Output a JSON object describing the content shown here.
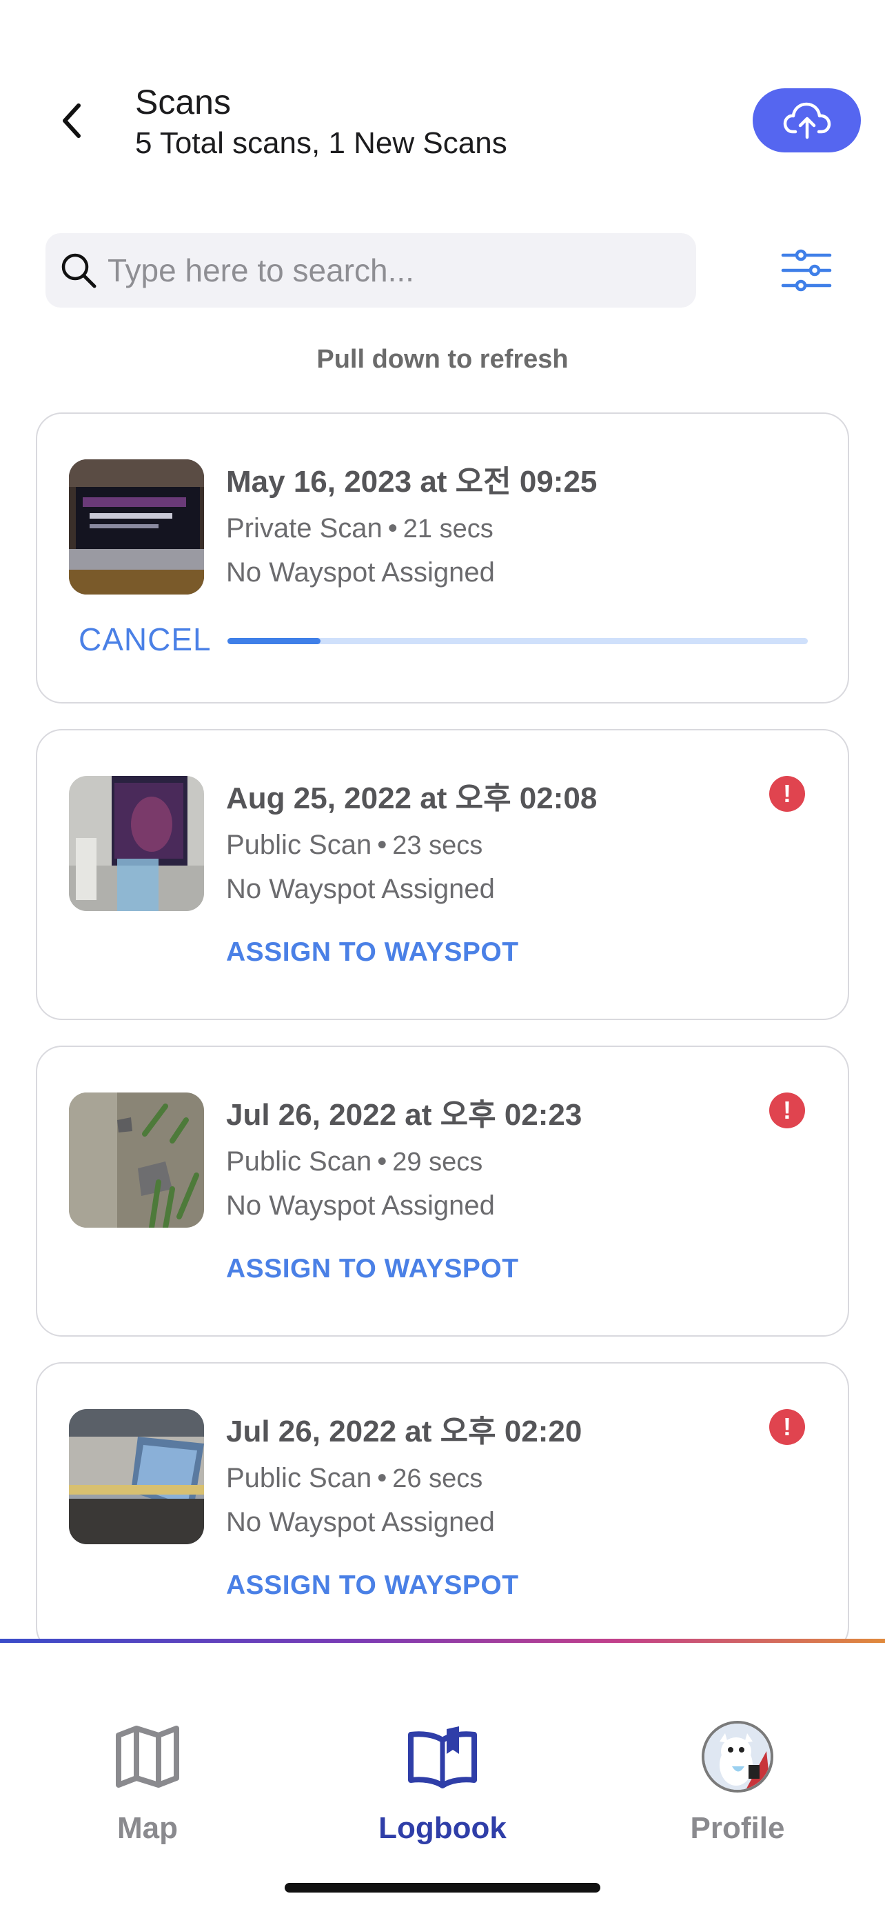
{
  "header": {
    "title": "Scans",
    "subtitle": "5 Total scans, 1 New Scans"
  },
  "search": {
    "placeholder": "Type here to search...",
    "value": ""
  },
  "refresh_hint": "Pull down to refresh",
  "scans": [
    {
      "date": "May 16, 2023 at 오전 09:25",
      "visibility": "Private Scan",
      "separator": "•",
      "duration": "21 secs",
      "wayspot": "No Wayspot Assigned",
      "action": "CANCEL",
      "progress": 0.16,
      "alert": false
    },
    {
      "date": "Aug 25, 2022 at 오후 02:08",
      "visibility": "Public Scan",
      "separator": "•",
      "duration": "23 secs",
      "wayspot": "No Wayspot Assigned",
      "action": "ASSIGN TO WAYSPOT",
      "alert": true,
      "alert_glyph": "!"
    },
    {
      "date": "Jul 26, 2022 at 오후 02:23",
      "visibility": "Public Scan",
      "separator": "•",
      "duration": "29 secs",
      "wayspot": "No Wayspot Assigned",
      "action": "ASSIGN TO WAYSPOT",
      "alert": true,
      "alert_glyph": "!"
    },
    {
      "date": "Jul 26, 2022 at 오후 02:20",
      "visibility": "Public Scan",
      "separator": "•",
      "duration": "26 secs",
      "wayspot": "No Wayspot Assigned",
      "action": "ASSIGN TO WAYSPOT",
      "alert": true,
      "alert_glyph": "!"
    }
  ],
  "nav": {
    "items": [
      {
        "label": "Map",
        "icon": "map-icon",
        "active": false
      },
      {
        "label": "Logbook",
        "icon": "logbook-icon",
        "active": true
      },
      {
        "label": "Profile",
        "icon": "avatar",
        "active": false
      }
    ]
  },
  "colors": {
    "accent": "#5566f0",
    "link": "#4a80e6",
    "alert": "#e0444f",
    "nav_active": "#2f3ea8"
  }
}
